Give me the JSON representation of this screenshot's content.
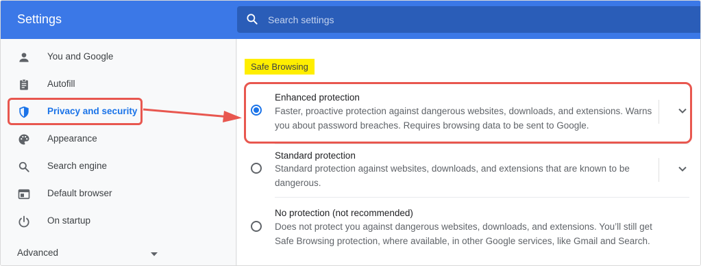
{
  "header": {
    "title": "Settings",
    "search_placeholder": "Search settings"
  },
  "sidebar": {
    "items": [
      {
        "label": "You and Google",
        "icon": "person-icon"
      },
      {
        "label": "Autofill",
        "icon": "clipboard-icon"
      },
      {
        "label": "Privacy and security",
        "icon": "shield-icon",
        "active": true
      },
      {
        "label": "Appearance",
        "icon": "palette-icon"
      },
      {
        "label": "Search engine",
        "icon": "search-icon"
      },
      {
        "label": "Default browser",
        "icon": "browser-icon"
      },
      {
        "label": "On startup",
        "icon": "power-icon"
      }
    ],
    "advanced_label": "Advanced"
  },
  "main": {
    "section_title": "Safe Browsing",
    "options": [
      {
        "title": "Enhanced protection",
        "description": "Faster, proactive protection against dangerous websites, downloads, and extensions. Warns you about password breaches. Requires browsing data to be sent to Google.",
        "selected": true
      },
      {
        "title": "Standard protection",
        "description": "Standard protection against websites, downloads, and extensions that are known to be dangerous.",
        "selected": false
      },
      {
        "title": "No protection (not recommended)",
        "description": "Does not protect you against dangerous websites, downloads, and extensions. You’ll still get Safe Browsing protection, where available, in other Google services, like Gmail and Search.",
        "selected": false
      }
    ]
  },
  "colors": {
    "header_bg": "#3b78e7",
    "search_bg": "#2a5db8",
    "accent": "#1a73e8",
    "annotation": "#e8574f",
    "section_highlight": "#ffee00"
  }
}
